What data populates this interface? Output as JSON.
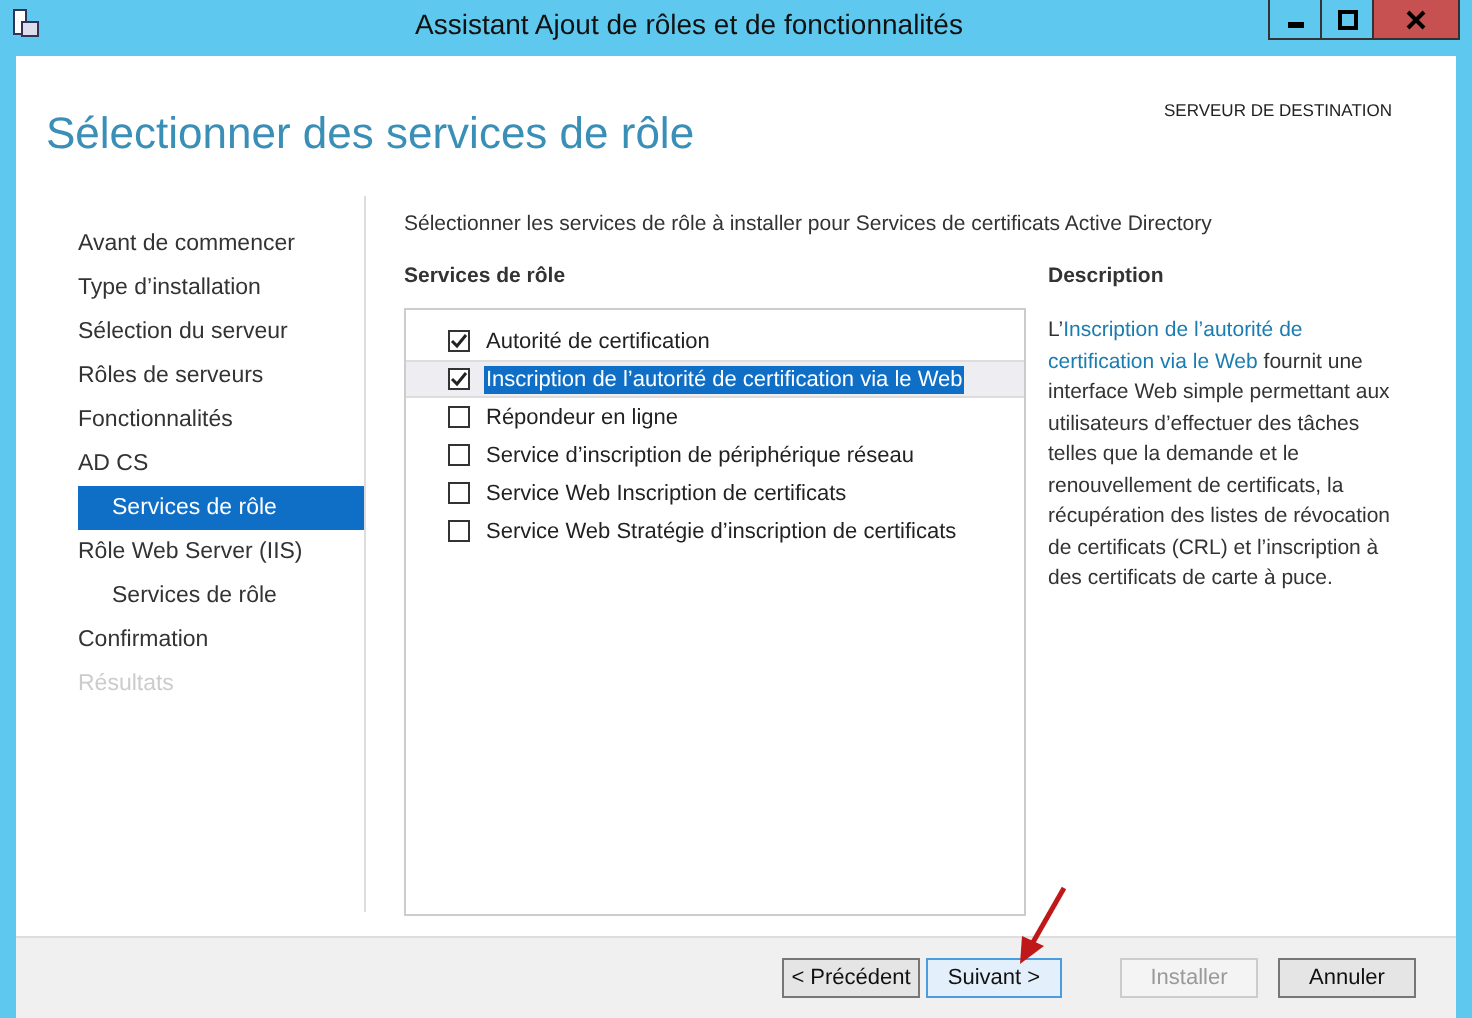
{
  "window": {
    "title": "Assistant Ajout de rôles et de fonctionnalités"
  },
  "header": {
    "title": "Sélectionner des services de rôle",
    "destination_label": "SERVEUR DE DESTINATION"
  },
  "sidebar": {
    "items": [
      {
        "label": "Avant de commencer",
        "selected": false,
        "disabled": false
      },
      {
        "label": "Type d’installation",
        "selected": false,
        "disabled": false
      },
      {
        "label": "Sélection du serveur",
        "selected": false,
        "disabled": false
      },
      {
        "label": "Rôles de serveurs",
        "selected": false,
        "disabled": false
      },
      {
        "label": "Fonctionnalités",
        "selected": false,
        "disabled": false
      },
      {
        "label": "AD CS",
        "selected": false,
        "disabled": false,
        "children": [
          {
            "label": "Services de rôle",
            "selected": true,
            "disabled": false
          }
        ]
      },
      {
        "label": "Rôle Web Server (IIS)",
        "selected": false,
        "disabled": false,
        "children": [
          {
            "label": "Services de rôle",
            "selected": false,
            "disabled": false
          }
        ]
      },
      {
        "label": "Confirmation",
        "selected": false,
        "disabled": false
      },
      {
        "label": "Résultats",
        "selected": false,
        "disabled": true
      }
    ]
  },
  "intro": "Sélectionner les services de rôle à installer pour Services de certificats Active Directory",
  "services": {
    "heading": "Services de rôle",
    "items": [
      {
        "label": "Autorité de certification",
        "checked": true,
        "selected": false
      },
      {
        "label": "Inscription de l’autorité de certification via le Web",
        "checked": true,
        "selected": true
      },
      {
        "label": "Répondeur en ligne",
        "checked": false,
        "selected": false
      },
      {
        "label": "Service d’inscription de périphérique réseau",
        "checked": false,
        "selected": false
      },
      {
        "label": "Service Web Inscription de certificats",
        "checked": false,
        "selected": false
      },
      {
        "label": "Service Web Stratégie d’inscription de certificats",
        "checked": false,
        "selected": false
      }
    ]
  },
  "description": {
    "heading": "Description",
    "prefix": "L’",
    "link": [
      "Inscription de l’autorité de",
      "certification via le Web"
    ],
    "text": " fournit une interface Web simple permettant aux utilisateurs d’effectuer des tâches telles que la demande et le renouvellement de certificats, la récupération des listes de révocation de certificats (CRL) et l’inscription à des certificats de carte à puce."
  },
  "buttons": [
    {
      "label": "< Précédent",
      "disabled": false,
      "focused": false
    },
    {
      "label": "Suivant >",
      "disabled": false,
      "focused": true
    },
    {
      "label": "Installer",
      "disabled": true,
      "focused": false
    },
    {
      "label": "Annuler",
      "disabled": false,
      "focused": false
    }
  ]
}
